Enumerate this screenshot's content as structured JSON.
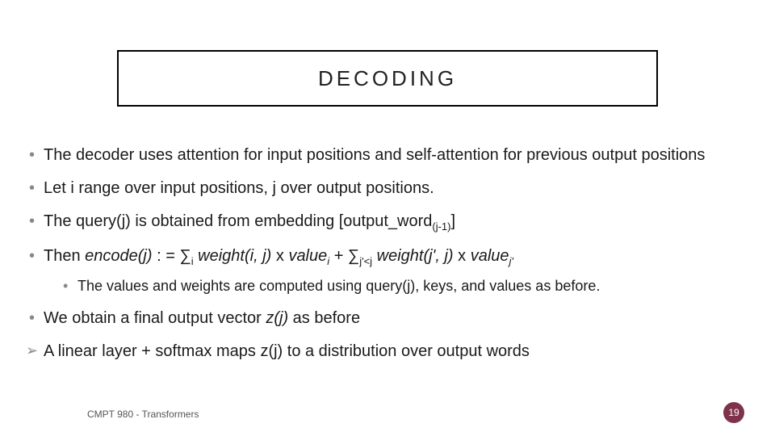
{
  "title": "DECODING",
  "bullets": {
    "b1": "The decoder uses attention for input positions and self-attention for previous output positions",
    "b2": "Let i range over input positions, j over output positions.",
    "b3_pre": "The query(j) is obtained from embedding [output_word",
    "b3_sub": "(j-1)",
    "b3_post": "]",
    "b4_pre": "Then ",
    "b4_enc": "encode(j)",
    "b4_mid1": " : = ∑",
    "b4_sub1": "i",
    "b4_mid2": " ",
    "b4_w1": "weight(i, j)",
    "b4_mid3": " x ",
    "b4_v1": "value",
    "b4_sub2": "i",
    "b4_mid4": " + ∑",
    "b4_sub3": "j'<j",
    "b4_mid5": " ",
    "b4_w2": "weight(j', j)",
    "b4_mid6": " x ",
    "b4_v2": "value",
    "b4_sub4": "j'",
    "b4_sublist": "The values and weights are computed using query(j), keys, and values as before.",
    "b5_pre": "We obtain a final output vector ",
    "b5_z": "z(j)",
    "b5_post": " as before",
    "b6": "A linear layer + softmax maps z(j) to a distribution over output words"
  },
  "footer": {
    "course": "CMPT 980 - Transformers",
    "page": "19"
  }
}
